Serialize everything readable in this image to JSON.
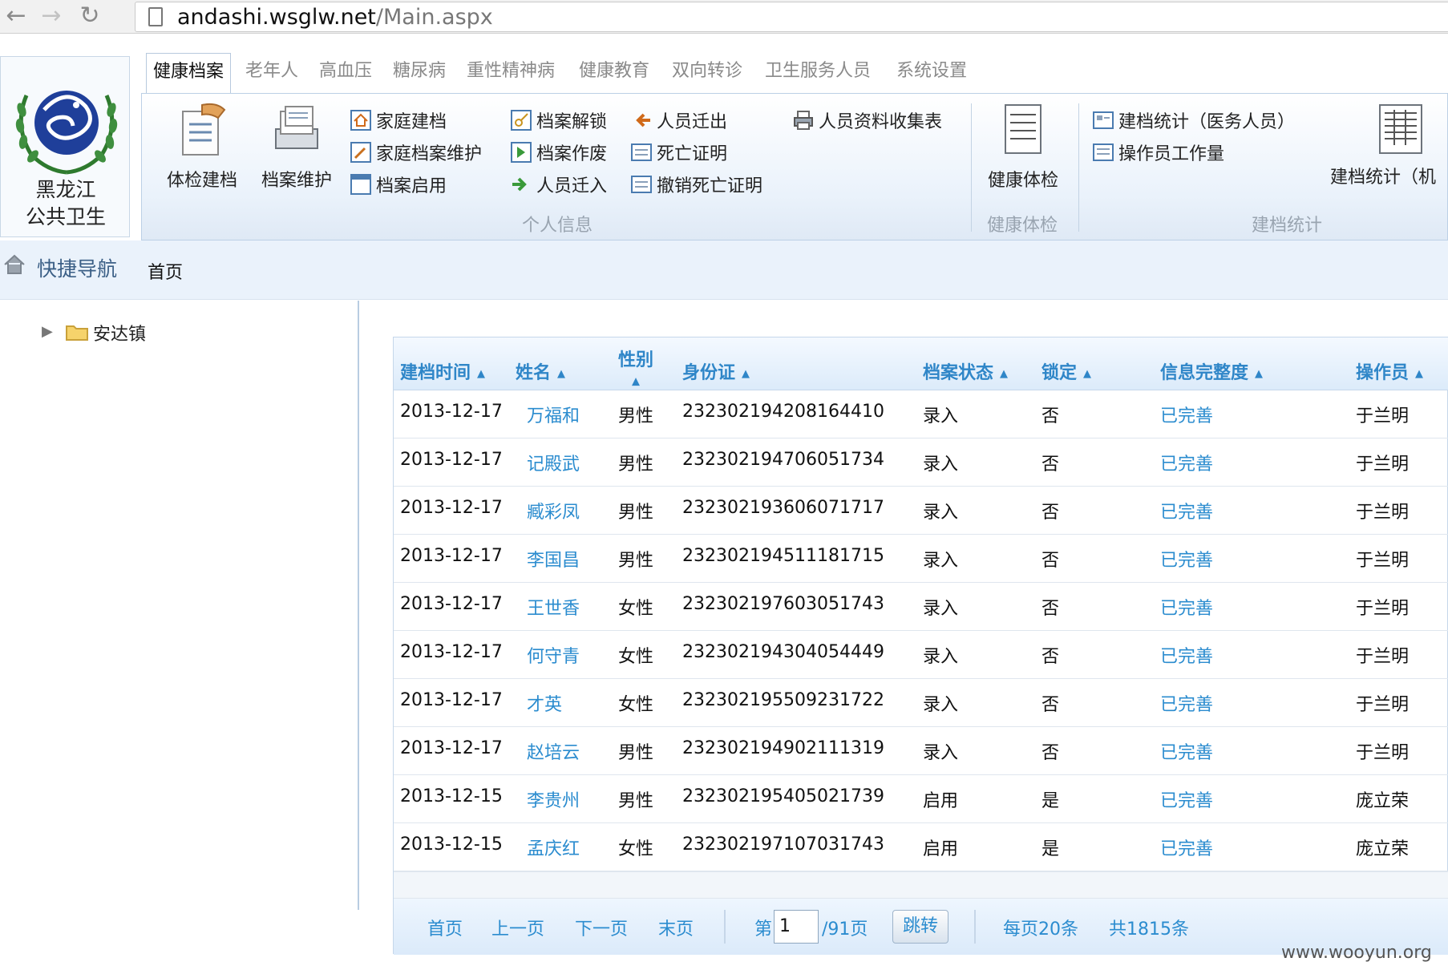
{
  "browser": {
    "url_host": "andashi.wsglw.net",
    "url_path": "/Main.aspx"
  },
  "logo": {
    "line1": "黑龙江",
    "line2": "公共卫生"
  },
  "tabs": [
    {
      "label": "健康档案",
      "active": true
    },
    {
      "label": "老年人"
    },
    {
      "label": "高血压"
    },
    {
      "label": "糖尿病"
    },
    {
      "label": "重性精神病"
    },
    {
      "label": "健康教育"
    },
    {
      "label": "双向转诊"
    },
    {
      "label": "卫生服务人员"
    },
    {
      "label": "系统设置"
    }
  ],
  "ribbon": {
    "personal": {
      "group_label": "个人信息",
      "big": [
        {
          "label": "体检建档"
        },
        {
          "label": "档案维护"
        }
      ],
      "small": [
        {
          "label": "家庭建档"
        },
        {
          "label": "家庭档案维护"
        },
        {
          "label": "档案启用"
        },
        {
          "label": "档案解锁"
        },
        {
          "label": "档案作废"
        },
        {
          "label": "人员迁入"
        },
        {
          "label": "人员迁出"
        },
        {
          "label": "死亡证明"
        },
        {
          "label": "撤销死亡证明"
        },
        {
          "label": "人员资料收集表"
        }
      ]
    },
    "health_exam": {
      "group_label": "健康体检",
      "big_label": "健康体检"
    },
    "stats": {
      "group_label": "建档统计",
      "small": [
        {
          "label": "建档统计（医务人员）"
        },
        {
          "label": "操作员工作量"
        }
      ],
      "big_label": "建档统计（机"
    }
  },
  "breadcrumb": {
    "quick_nav": "快捷导航",
    "home": "首页"
  },
  "tree": {
    "root_label": "安达镇"
  },
  "table": {
    "headers": {
      "date": "建档时间",
      "name": "姓名",
      "gender": "性别",
      "id": "身份证",
      "status": "档案状态",
      "locked": "锁定",
      "completeness": "信息完整度",
      "operator": "操作员"
    },
    "rows": [
      {
        "date": "2013-12-17",
        "name": "万福和",
        "gender": "男性",
        "id": "232302194208164410",
        "status": "录入",
        "locked": "否",
        "completeness": "已完善",
        "operator": "于兰明"
      },
      {
        "date": "2013-12-17",
        "name": "记殿武",
        "gender": "男性",
        "id": "232302194706051734",
        "status": "录入",
        "locked": "否",
        "completeness": "已完善",
        "operator": "于兰明"
      },
      {
        "date": "2013-12-17",
        "name": "臧彩凤",
        "gender": "男性",
        "id": "232302193606071717",
        "status": "录入",
        "locked": "否",
        "completeness": "已完善",
        "operator": "于兰明"
      },
      {
        "date": "2013-12-17",
        "name": "李国昌",
        "gender": "男性",
        "id": "232302194511181715",
        "status": "录入",
        "locked": "否",
        "completeness": "已完善",
        "operator": "于兰明"
      },
      {
        "date": "2013-12-17",
        "name": "王世香",
        "gender": "女性",
        "id": "232302197603051743",
        "status": "录入",
        "locked": "否",
        "completeness": "已完善",
        "operator": "于兰明"
      },
      {
        "date": "2013-12-17",
        "name": "何守青",
        "gender": "女性",
        "id": "232302194304054449",
        "status": "录入",
        "locked": "否",
        "completeness": "已完善",
        "operator": "于兰明"
      },
      {
        "date": "2013-12-17",
        "name": "才英",
        "gender": "女性",
        "id": "232302195509231722",
        "status": "录入",
        "locked": "否",
        "completeness": "已完善",
        "operator": "于兰明"
      },
      {
        "date": "2013-12-17",
        "name": "赵培云",
        "gender": "男性",
        "id": "232302194902111319",
        "status": "录入",
        "locked": "否",
        "completeness": "已完善",
        "operator": "于兰明"
      },
      {
        "date": "2013-12-15",
        "name": "李贵州",
        "gender": "男性",
        "id": "232302195405021739",
        "status": "启用",
        "locked": "是",
        "completeness": "已完善",
        "operator": "庞立荣"
      },
      {
        "date": "2013-12-15",
        "name": "孟庆红",
        "gender": "女性",
        "id": "232302197107031743",
        "status": "启用",
        "locked": "是",
        "completeness": "已完善",
        "operator": "庞立荣"
      }
    ]
  },
  "pager": {
    "first": "首页",
    "prev": "上一页",
    "next": "下一页",
    "last": "末页",
    "page_prefix": "第",
    "page_value": "1",
    "page_suffix": "/91页",
    "jump": "跳转",
    "per_page": "每页20条",
    "total": "共1815条"
  },
  "watermark": "www.wooyun.org"
}
